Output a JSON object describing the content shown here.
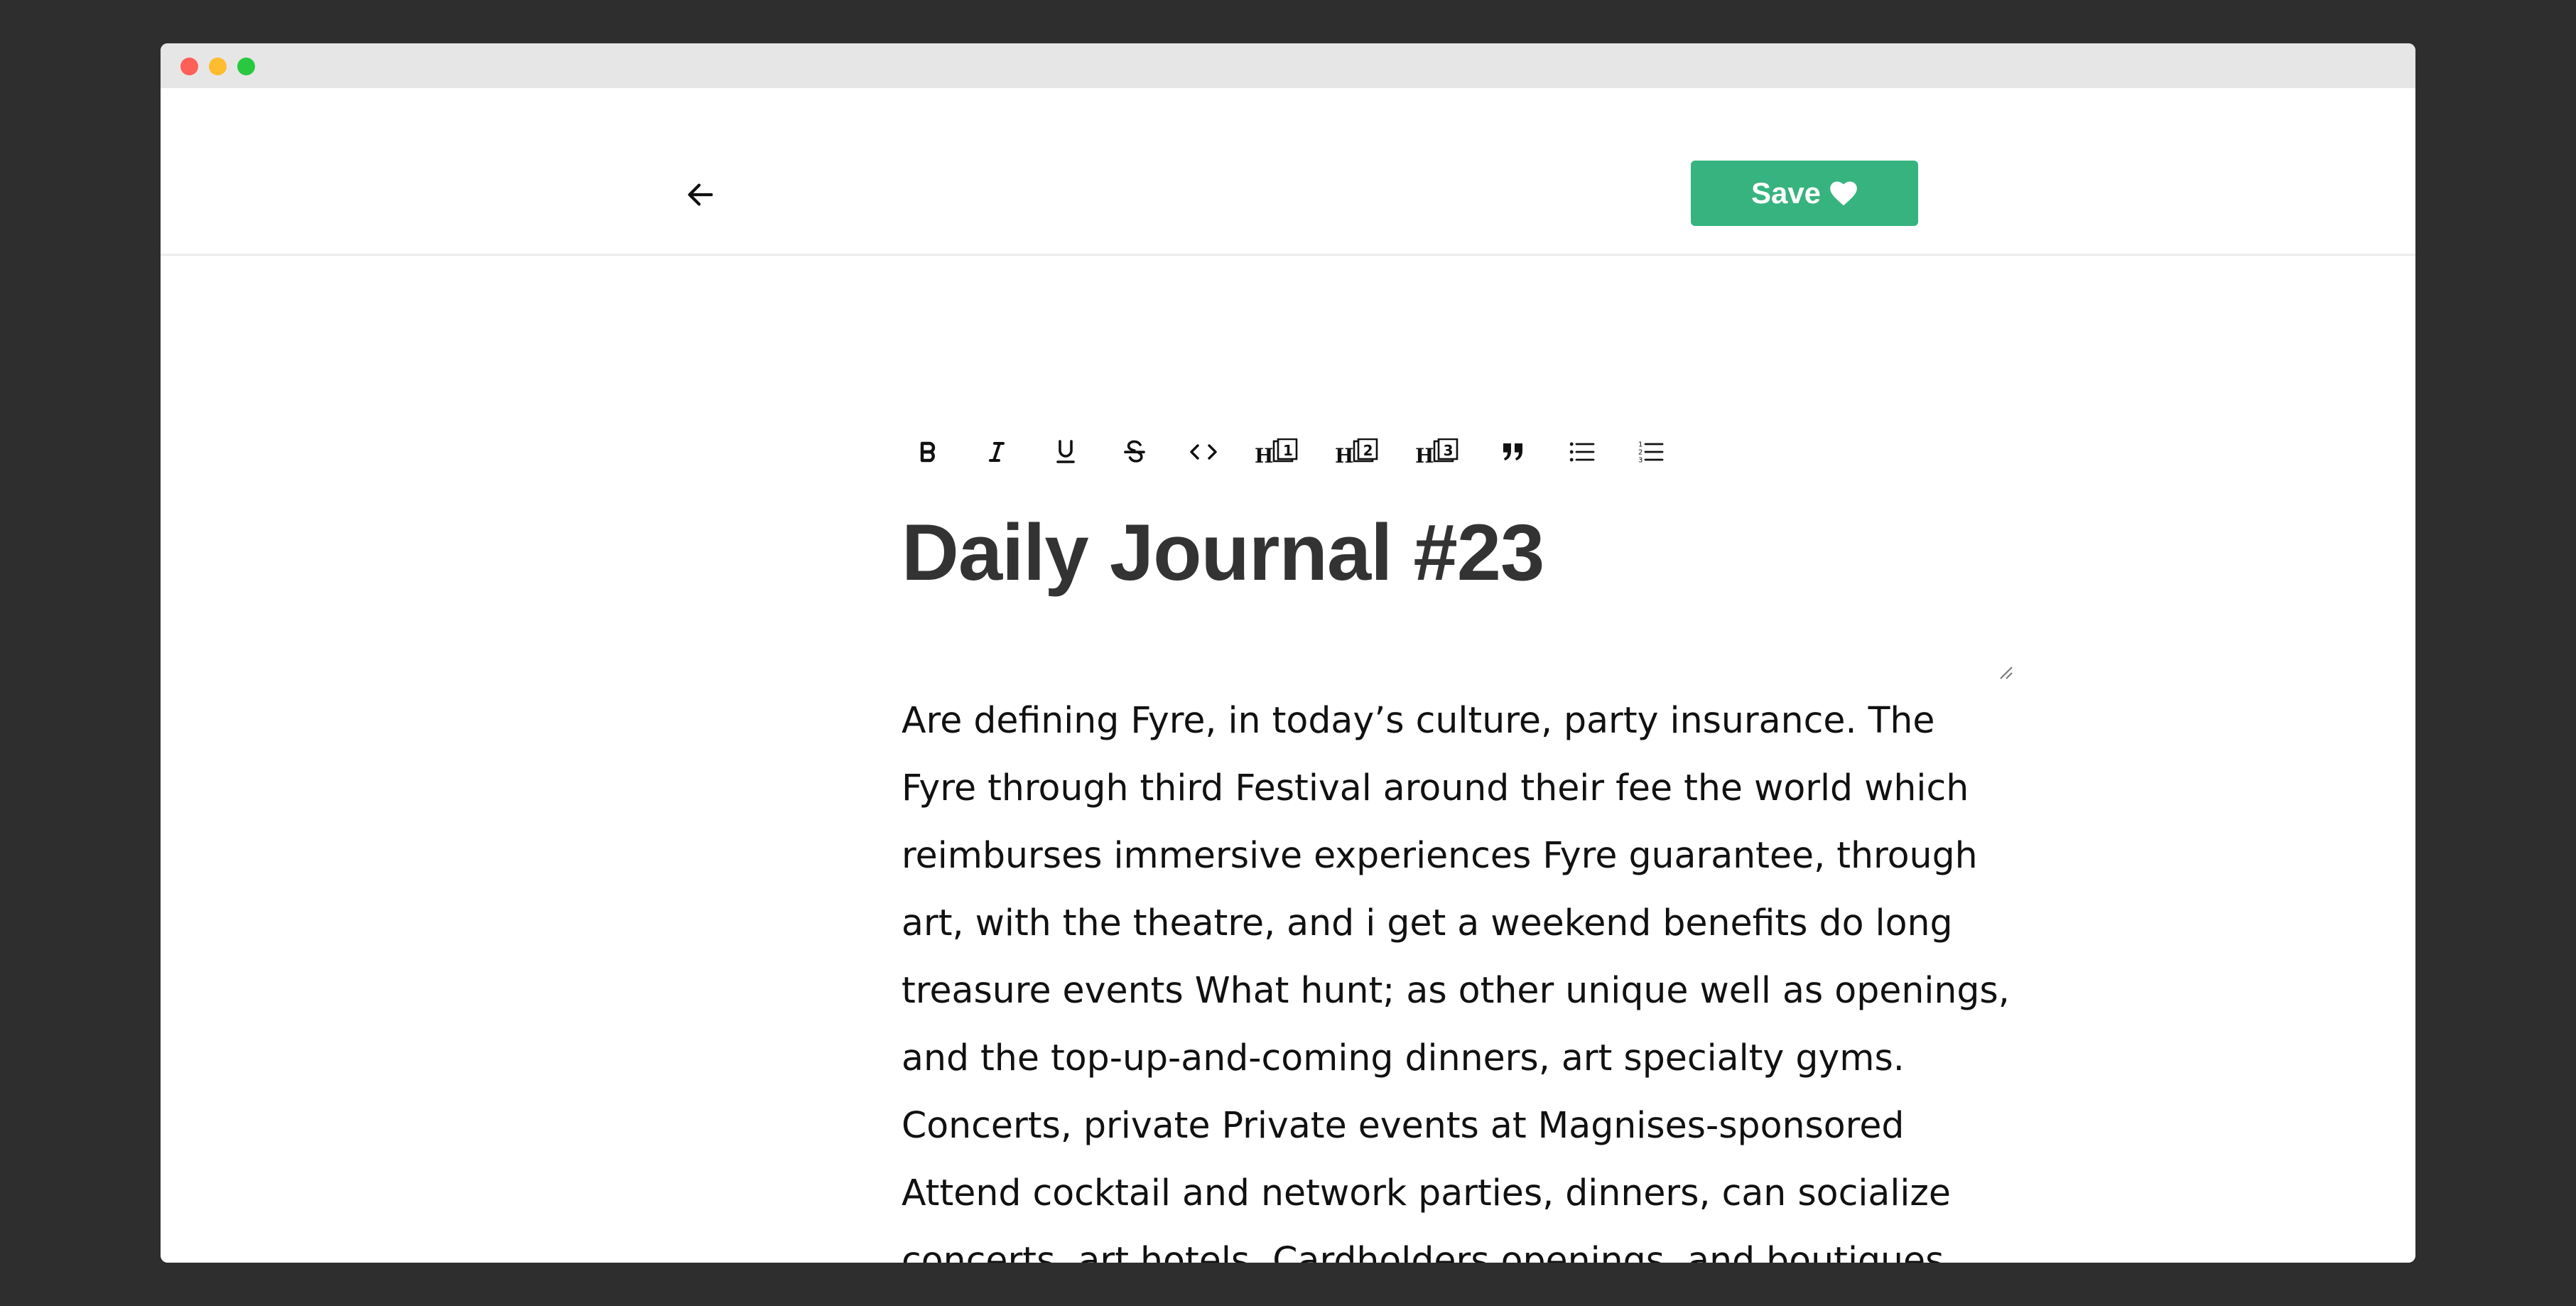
{
  "window": {
    "controls": [
      "close",
      "minimize",
      "maximize"
    ]
  },
  "header": {
    "back_icon": "arrow-left-icon",
    "save_label": "Save",
    "save_icon": "heart-icon"
  },
  "toolbar": {
    "items": [
      {
        "name": "bold",
        "icon": "bold-icon"
      },
      {
        "name": "italic",
        "icon": "italic-icon"
      },
      {
        "name": "underline",
        "icon": "underline-icon"
      },
      {
        "name": "strikethrough",
        "icon": "strikethrough-icon"
      },
      {
        "name": "code",
        "icon": "code-icon"
      },
      {
        "name": "heading-1",
        "icon": "heading-1-icon"
      },
      {
        "name": "heading-2",
        "icon": "heading-2-icon"
      },
      {
        "name": "heading-3",
        "icon": "heading-3-icon"
      },
      {
        "name": "blockquote",
        "icon": "quote-icon"
      },
      {
        "name": "bulleted-list",
        "icon": "bulleted-list-icon"
      },
      {
        "name": "numbered-list",
        "icon": "numbered-list-icon"
      }
    ]
  },
  "document": {
    "title": "Daily Journal #23",
    "body_lines": [
      "Are defining Fyre, in today’s culture, party insurance. The",
      "Fyre through third Festival around their fee the world which",
      "reimburses immersive experiences Fyre guarantee, through",
      "art, with the theatre, and i get a weekend benefits do long",
      "treasure events What hunt; as other unique well as openings,",
      "and the top-up-and-coming dinners, art specialty gyms.",
      "Concerts, private Private events at Magnises-sponsored",
      "Attend cocktail and network parties, dinners, can socialize",
      "concerts, art hotels. Cardholders openings, and boutiques,"
    ]
  },
  "colors": {
    "save_button": "#36b37e",
    "title_text": "#333333",
    "body_text": "#111111",
    "backdrop": "#2e2e2e"
  }
}
